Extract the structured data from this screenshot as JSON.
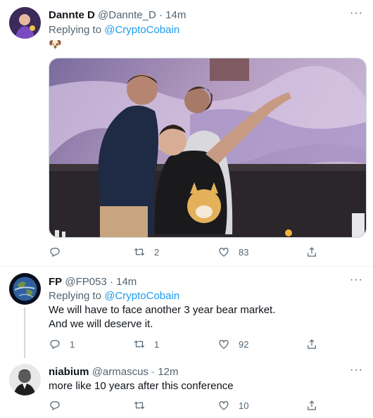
{
  "tweets": [
    {
      "name": "Dannte D",
      "handle": "@Dannte_D",
      "time": "14m",
      "replying_prefix": "Replying to",
      "replying_to": "@CryptoCobain",
      "emoji": "🐶",
      "replies": "",
      "retweets": "2",
      "likes": "83"
    },
    {
      "name": "FP",
      "handle": "@FP053",
      "time": "14m",
      "replying_prefix": "Replying to",
      "replying_to": "@CryptoCobain",
      "line1": "We will have to face another 3 year bear market.",
      "line2": "And we will deserve it.",
      "replies": "1",
      "retweets": "1",
      "likes": "92"
    },
    {
      "name": "niabium",
      "handle": "@armascus",
      "time": "12m",
      "line1": "more like 10 years after this conference",
      "replies": "",
      "retweets": "",
      "likes": "10"
    }
  ],
  "dot": "·",
  "more": "···",
  "colors": {
    "accent": "#1d9bf0",
    "secondary_text": "#536471",
    "primary_text": "#0f1419"
  }
}
